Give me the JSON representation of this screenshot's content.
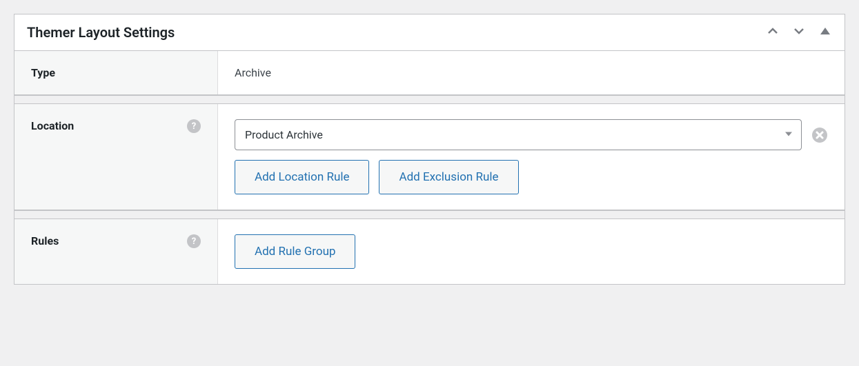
{
  "panel": {
    "title": "Themer Layout Settings"
  },
  "type": {
    "label": "Type",
    "value": "Archive"
  },
  "location": {
    "label": "Location",
    "select_value": "Product Archive",
    "add_location_btn": "Add Location Rule",
    "add_exclusion_btn": "Add Exclusion Rule"
  },
  "rules": {
    "label": "Rules",
    "add_group_btn": "Add Rule Group"
  }
}
